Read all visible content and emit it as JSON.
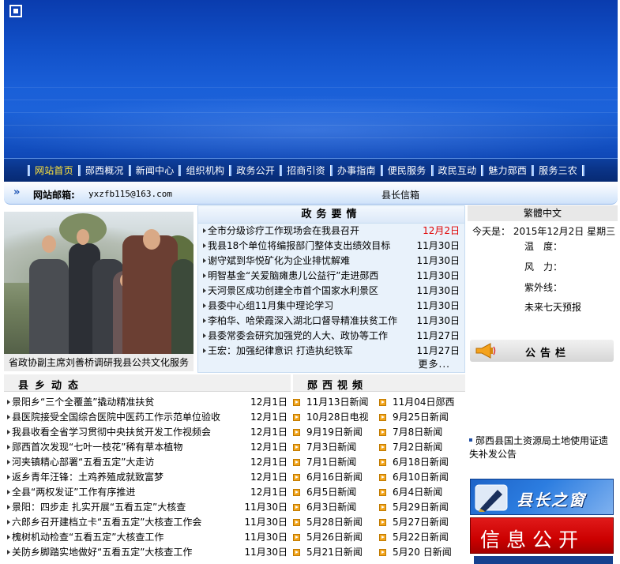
{
  "nav": {
    "items": [
      {
        "label": "网站首页",
        "active": true
      },
      {
        "label": "郧西概况"
      },
      {
        "label": "新闻中心"
      },
      {
        "label": "组织机构"
      },
      {
        "label": "政务公开"
      },
      {
        "label": "招商引资"
      },
      {
        "label": "办事指南"
      },
      {
        "label": "便民服务"
      },
      {
        "label": "政民互动"
      },
      {
        "label": "魅力郧西"
      },
      {
        "label": "服务三农"
      }
    ]
  },
  "mailbar": {
    "label": "网站邮箱:",
    "address": "yxzfb115@163.com",
    "mayor_mailbox": "县长信箱"
  },
  "photo": {
    "caption": "省政协副主席刘善桥调研我县公共文化服务"
  },
  "gov_news": {
    "title": "政务要情",
    "more": "更多...",
    "items": [
      {
        "title": "全市分级诊疗工作现场会在我县召开",
        "date": "12月2日",
        "highlight": true
      },
      {
        "title": "我县18个单位将编报部门整体支出绩效目标",
        "date": "11月30日"
      },
      {
        "title": "谢守斌到华悦矿化为企业排忧解难",
        "date": "11月30日"
      },
      {
        "title": "明智基金“关爱脑瘫患儿公益行”走进郧西",
        "date": "11月30日"
      },
      {
        "title": "天河景区成功创建全市首个国家水利景区",
        "date": "11月30日"
      },
      {
        "title": "县委中心组11月集中理论学习",
        "date": "11月30日"
      },
      {
        "title": "李柏华、哈荣霞深入湖北口督导精准扶贫工作",
        "date": "11月30日"
      },
      {
        "title": "县委常委会研究加强党的人大、政协等工作",
        "date": "11月27日"
      },
      {
        "title": "王宏：加强纪律意识 打造执纪铁军",
        "date": "11月27日"
      }
    ]
  },
  "right": {
    "traditional": "繁體中文",
    "today_label": "今天是：",
    "today_value": "2015年12月2日 星期三",
    "temperature_label": "温　度：",
    "wind_label": "风　力：",
    "uv_label": "紫外线：",
    "forecast": "未来七天预报",
    "notice_title": "公告栏",
    "notice_item": "郧西县国土资源局土地使用证遗失补发公告",
    "promo1": "县长之窗",
    "promo2": "信息公开"
  },
  "county_news": {
    "title": "县乡动态",
    "items": [
      {
        "title": "景阳乡“三个全覆盖”撬动精准扶贫",
        "date": "12月1日"
      },
      {
        "title": "县医院接受全国综合医院中医药工作示范单位验收",
        "date": "12月1日"
      },
      {
        "title": "我县收看全省学习贯彻中央扶贫开发工作视频会",
        "date": "12月1日"
      },
      {
        "title": "郧西首次发现“七叶一枝花”稀有草本植物",
        "date": "12月1日"
      },
      {
        "title": "河夹镇精心部署“五看五定”大走访",
        "date": "12月1日"
      },
      {
        "title": "返乡青年汪锋：土鸡养殖成就致富梦",
        "date": "12月1日"
      },
      {
        "title": "全县“两权发证”工作有序推进",
        "date": "12月1日"
      },
      {
        "title": "景阳：四步走 扎实开展“五看五定”大核查",
        "date": "11月30日"
      },
      {
        "title": "六郎乡召开建档立卡“五看五定”大核查工作会",
        "date": "11月30日"
      },
      {
        "title": "槐树机动检查“五看五定”大核查工作",
        "date": "11月30日"
      },
      {
        "title": "关防乡脚踏实地做好“五看五定”大核查工作",
        "date": "11月30日"
      }
    ]
  },
  "video": {
    "title": "郧西视频",
    "items": [
      "11月13日新闻",
      "11月04日郧西",
      "10月28日电视",
      "9月25日新闻",
      "9月19日新闻",
      "7月8日新闻",
      "7月3日新闻",
      "7月2日新闻",
      "7月1日新闻",
      "6月18日新闻",
      "6月16日新闻",
      "6月10日新闻",
      "6月5日新闻",
      "6月4日新闻",
      "6月3日新闻",
      "5月29日新闻",
      "5月28日新闻",
      "5月27日新闻",
      "5月26日新闻",
      "5月22日新闻",
      "5月21日新闻",
      "5月20 日新闻"
    ]
  },
  "colors": {
    "banner": "#1a5fd8",
    "nav": "#0a3488",
    "nav_active": "#ffe33a",
    "date_highlight": "#e00000",
    "gov_bg": "#e9f2fb",
    "promo_red": "#cc0000"
  }
}
